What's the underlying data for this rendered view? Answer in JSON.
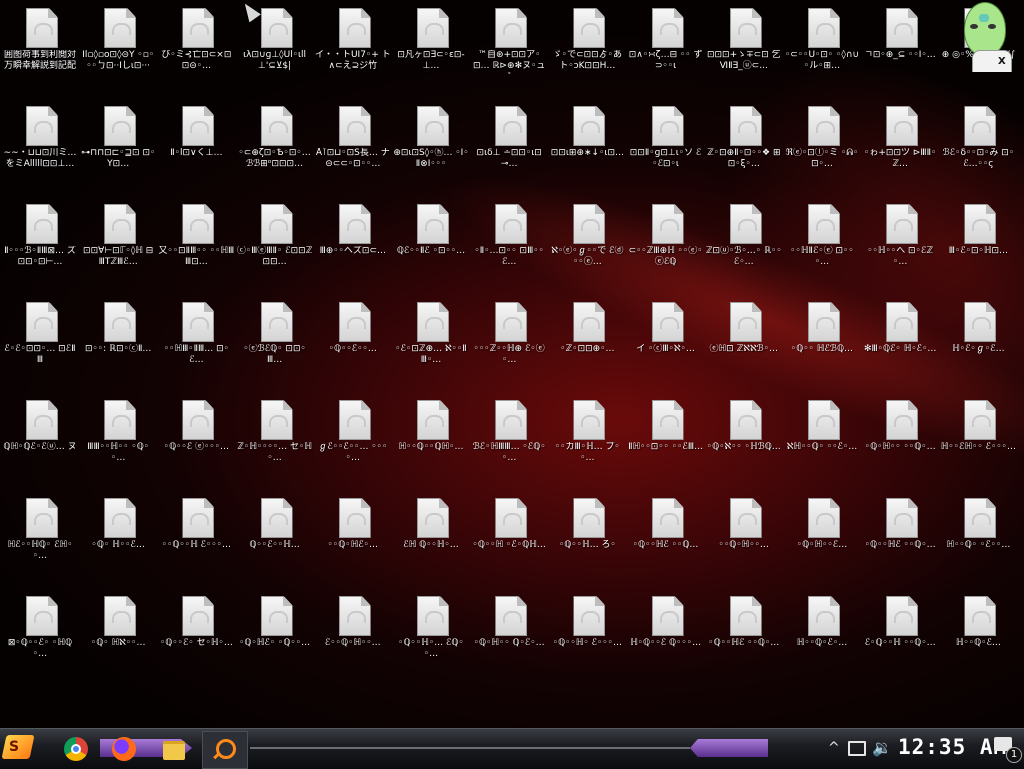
{
  "desktop": {
    "icons": [
      [
        "囲图荷事到利閲対 万瞬幸解説到記配",
        "Il▫◊▫ο⊡◊⊝Ϋ ◦▫◦◦◦ㄅ⊡··Ιしι⊡···",
        "び◦ミ⊰亡⊡⊂×⊡ ⊡⊝◦…",
        "ιλ⊡∪ɡ⊥◊Ul◦ιll ⊥'⊆⊻$|",
        "イ・・トUI7◦+ ト∧⊂え⊇ジ竹",
        "⊡凡ヶ⊡∃⊂◦ε⊡-⊥…",
        "™自⊛+⊡⊡ア◦⊡… ℝ⊳⊕✻ヌ◦ュ⊺",
        "ゞ◦で⊂⊡⊡ゟ◦あ ト◦ɔK⊡⊡H…",
        "⊡∧◦∺ζ…⊟ ◦◦ ず⊃◦◦ι",
        "⊡⊡⊡+ゝ∓⊂⊡ 乞ⅥⅡ∃_ⓤ⊂...",
        "◦⊂◦◦U◦⊡◦ ◦◊∩∪◦ル◦⊞…",
        "ㄱ⊡◦⊕_⊆ ◦◦I◦…",
        "⊕ ◎◦%◦◦ⅢЯⅡ X∫"
      ],
      [
        "∼∼・⊔⊔⊡川ミ… をミAlllll⊡⊡⊥…",
        "⊶⊓⊓⊡⊏◦⊒⊡ ⊡◦Y⊡…",
        "Ⅱ◦l⊡∨く⊥…",
        "◦⊂⊕ζ⊡◦Ѣ◦⊡◦… ℬℬ⊞ᵒ⊡⊡⊡…",
        "Å⊺⊡⊔◦⊡S長… ナ⊝⊂⊂◦⊡◦◦…",
        "⊕⊡ι⊡S◊◦ⓗ… ◦I◦Ⅱ⊗I◦◦◦",
        "⊡ιδ⊥ ∸⊡⊡◦ι⊡⊸…",
        "⊡⊡ι⊞⊕∗↓◦ι⊡…",
        "⊡⊡Ⅱ◦ɡ⊡⊥ι◦ソ ℰ◦ℰ⊡◦ι",
        "ℤ◦⊡⊕Ⅱ◦⊡◦◦❖ ⊞⊡◦ξ◦…",
        "ℜⓔ◦⊡ⓛ◦ミ ◦ᕱ◦⊡◦…",
        "◦ゎ+⊡⊡ツ ⊳ⅢⅡ◦ℤ…",
        "ℬℰ◦δ◦◦⊡◦み ⊡◦ℰ…◦◦ς"
      ],
      [
        "Ⅱ◦◦◦ℬ◦ⅡⅢ⊠… ズ⊡⊡◦⊡⊢…",
        "⊡⊡∀⊢⊡ℾ◦◊ℍ ⊟ⅢTℤⅢℰ…",
        "又◦◦⊡ⅡⅢ◦◦ ◦◦ℍⅢⅢ⊡…",
        "ⓒ◦ⅢⓔⅢⅡ◦ ℰ⊡⊡ℤ⊡⊡…",
        "Ⅲ⊕◦◦ヘズ⊡⊂…",
        "ℚℰ◦◦Ⅱℰ ◦⊡◦◦…",
        "◦Ⅱ◦…⊡◦◦ ⊡Ⅲ◦◦ℰ…",
        "ℵ◦ⓔ◦ℊ◦◦で ℰⓓ◦◦ⓔ…",
        "⊂◦◦ℤⅢ⊕ℍ ◦◦ⓔ◦ⓔℰℚ",
        "ℤ⊡ⓤ◦ℬ◦…◦ ℝ◦◦ℰ◦…",
        "◦◦ℍⅡℰ◦ⓔ ⊡◦◦◦…",
        "◦◦ℍ◦◦へ ⊡◦ℰℤ◦…",
        "Ⅲ◦ℰ◦⊡◦ℍ⊡…"
      ],
      [
        "ℰ◦ℰ◦⊡⊡◦… ⊡ℰⅡⅢ",
        "⊡◦◦: ℝ⊡◦ⓒⅡ…",
        "◦◦ℍⅢ◦ⅡⅢ… ⊡◦ℰ…",
        "◦ⓔℬℰℚ◦ ⊡⊡◦Ⅲ…",
        "◦ℚ◦◦ℰ◦◦… ",
        "◦ℰ◦⊡ℤ⊕… ℵ◦◦ⅡⅢ◦…",
        "◦◦◦ℤ◦◦ℍ⊕ ℰ◦ⓔ◦…",
        "◦ℤ◦⊡⊡⊕◦…",
        "イ ◦ⓒⅢ◦ℵ◦…",
        "ⓔℍ⊡ ℤℵℵℬ◦…",
        "◦ℚ◦◦ ℍℰℬℚ…",
        "✻Ⅲ◦ℚℰ◦ ℍ◦ℰ◦…",
        "ℍ◦ℰ◦ℊ◦ℰ…"
      ],
      [
        "ℚℍ◦ℚℰ◦ℰⓤ… ヌ",
        "ⅢⅢ◦◦ℍ◦◦ ◦ℚ◦◦…",
        "◦ℚ◦◦ℰ ⓔ◦◦◦…",
        "ℤ◦ℍ◦◦◦◦… セ◦ℍ◦…",
        "ℊℰ◦◦ℰ◦◦… ◦◦◦◦…",
        "ℍ◦◦ℚ◦◦ℚℍ◦…",
        "ℬℰ◦ℍⅢⅢ… ◦ℰℚ◦◦…",
        "◦◦カⅢ◦ℍ… プ◦◦…",
        "Ⅱℍ◦◦⊡◦◦ ◦◦ℰⅢ…",
        "◦ℚ◦ℵ◦◦ ◦ℍℬℚ…",
        "ℵℍ◦◦ℚ◦ ◦◦ℰ◦…",
        "◦ℚ◦ℍ◦◦ ◦◦ℚ◦…",
        "ℍ◦◦ℰℍ◦◦ ℰ◦◦◦…"
      ],
      [
        "ℍℰ◦◦ℍℚ◦ ℰℍ◦◦…",
        "◦ℚ◦ ℍ◦◦ℰ…",
        "◦◦ℚ◦◦ℍ ℰ◦◦◦…",
        "ℚ◦◦ℰ◦◦ℍ…",
        "◦◦ℚ◦ℍℰ◦…",
        "ℰℍ ℚ◦◦ℍ◦…",
        "◦ℚ◦◦ℍ ◦ℰ◦ℚℍ…",
        "◦ℚ◦◦ℍ… ろ◦",
        "◦ℚ◦◦ℍℰ ◦◦ℚ…",
        "◦◦ℚ◦ℍ◦◦…",
        "◦ℚ◦ℍ◦◦ℰ…",
        "◦ℚ◦◦ℍℰ ◦◦ℚ◦…",
        "ℍ◦◦ℚ◦ ◦ℰ◦◦…"
      ],
      [
        "⊠◦ℚ◦◦ℰ◦ ◦ℍℚ◦…",
        "◦ℚ◦ ℍℵ◦◦…",
        "◦ℚ◦◦ℰ◦ セ◦ℍ◦…",
        "◦ℚ◦ℍℰ◦ ◦ℚ◦◦…",
        "ℰ◦◦ℚ◦ℍ◦◦…",
        "◦ℚ◦◦ℍ◦… ℰℚ◦◦…",
        "◦ℚ◦ℍ◦◦ ℚ◦ℰ◦…",
        "◦ℚ◦◦ℍ◦ ℰ◦◦◦…",
        "ℍ◦ℚ◦◦ℰ ℚ◦◦◦…",
        "◦ℚ◦◦ℍℰ ◦◦ℚ◦…",
        "ℍ◦◦ℚ◦ℰ◦…",
        "ℰ◦ℚ◦◦ℍ ◦◦ℚ◦…",
        "ℍ◦◦ℚ◦ℰ…"
      ]
    ]
  },
  "taskbar": {
    "start_label": "S",
    "apps": [
      "chrome",
      "firefox",
      "file-explorer",
      "search"
    ],
    "clock": "12:35 AM",
    "notification_count": "1"
  }
}
